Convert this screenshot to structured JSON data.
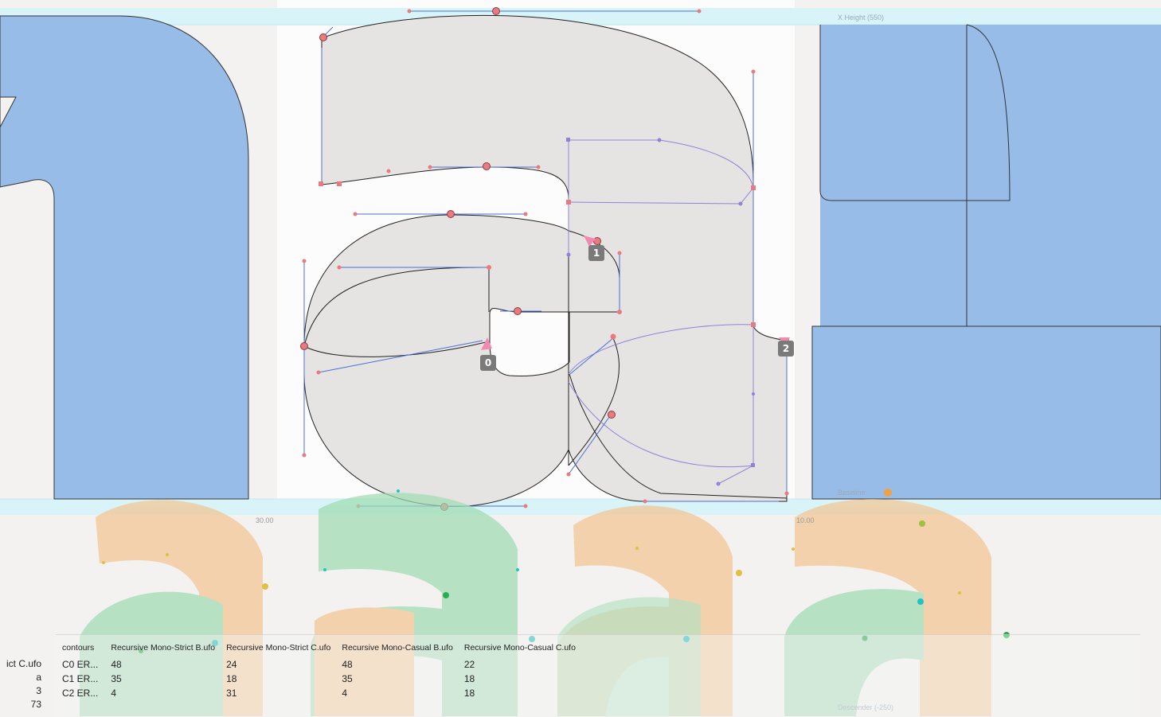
{
  "metrics": {
    "x_height_label": "X Height (550)",
    "baseline_label": "Baseline",
    "descender_label": "Descender (-250)"
  },
  "ruler": {
    "left_value": "30.00",
    "right_value": "10.00"
  },
  "point_badges": [
    "0",
    "1",
    "2"
  ],
  "left_panel": {
    "font_name": "ict C.ufo",
    "glyph_name": "a",
    "contour_count": "3",
    "point_count": "73"
  },
  "table": {
    "headers": [
      "contours",
      "Recursive Mono-Strict B.ufo",
      "Recursive Mono-Strict C.ufo",
      "Recursive Mono-Casual B.ufo",
      "Recursive Mono-Casual C.ufo"
    ],
    "rows": [
      {
        "name": "C0 ER...",
        "values": [
          "48",
          "24",
          "48",
          "22"
        ]
      },
      {
        "name": "C1 ER...",
        "values": [
          "35",
          "18",
          "35",
          "18"
        ]
      },
      {
        "name": "C2 ER...",
        "values": [
          "4",
          "31",
          "4",
          "18"
        ]
      }
    ]
  },
  "colors": {
    "neighbor_fill": "#97bce8",
    "glyph_fill": "#e6e4e3",
    "guide_band": "#d8f4f8",
    "point_red": "#e87a80",
    "handle_blue": "#4b6fd6",
    "handle_purple": "#8d84d8",
    "preview_orange": "#f2c48f",
    "preview_green": "#9edbb0"
  }
}
